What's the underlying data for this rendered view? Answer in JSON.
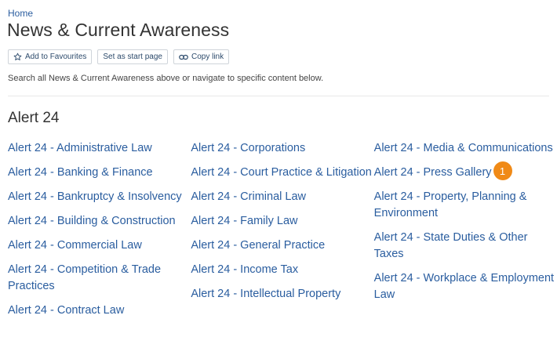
{
  "breadcrumb": {
    "home": "Home"
  },
  "page": {
    "title": "News & Current Awareness"
  },
  "actions": {
    "favourites": {
      "label": "Add to Favourites",
      "icon": "star-icon"
    },
    "start_page": {
      "label": "Set as start page"
    },
    "copy_link": {
      "label": "Copy link",
      "icon": "link-icon"
    }
  },
  "intro": "Search all News & Current Awareness above or navigate to specific content below.",
  "section": {
    "title": "Alert 24"
  },
  "columns": [
    [
      "Alert 24 - Administrative Law",
      "Alert 24 - Banking & Finance",
      "Alert 24 - Bankruptcy & Insolvency",
      "Alert 24 - Building & Construction",
      "Alert 24 - Commercial Law",
      "Alert 24 - Competition & Trade Practices",
      "Alert 24 - Contract Law"
    ],
    [
      "Alert 24 - Corporations",
      "Alert 24 - Court Practice & Litigation",
      "Alert 24 - Criminal Law",
      "Alert 24 - Family Law",
      "Alert 24 - General Practice",
      "Alert 24 - Income Tax",
      "Alert 24 - Intellectual Property"
    ],
    [
      "Alert 24 - Media & Communications",
      "Alert 24 - Press Gallery",
      "Alert 24 - Property, Planning & Environment",
      "Alert 24 - State Duties & Other Taxes",
      "Alert 24 - Workplace & Employment Law"
    ]
  ],
  "badge": {
    "count": "1"
  },
  "colors": {
    "link": "#2a5d9f",
    "badge": "#f08a17"
  }
}
